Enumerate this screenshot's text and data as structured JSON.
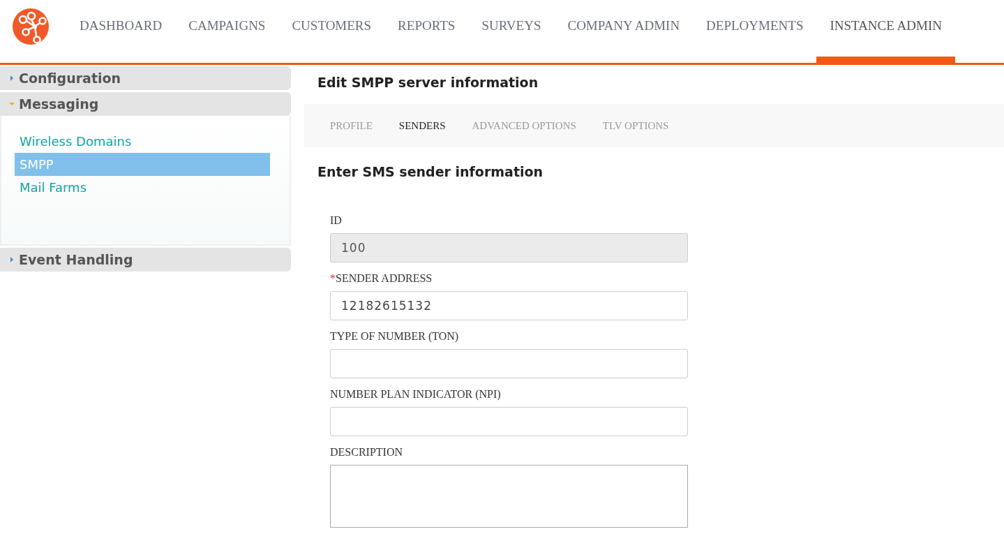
{
  "nav": {
    "items": [
      {
        "label": "DASHBOARD",
        "selected": false
      },
      {
        "label": "CAMPAIGNS",
        "selected": false
      },
      {
        "label": "CUSTOMERS",
        "selected": false
      },
      {
        "label": "REPORTS",
        "selected": false
      },
      {
        "label": "SURVEYS",
        "selected": false
      },
      {
        "label": "COMPANY ADMIN",
        "selected": false
      },
      {
        "label": "DEPLOYMENTS",
        "selected": false
      },
      {
        "label": "INSTANCE ADMIN",
        "selected": true
      }
    ]
  },
  "sidebar": {
    "sections": [
      {
        "label": "Configuration",
        "expanded": false
      },
      {
        "label": "Messaging",
        "expanded": true,
        "items": [
          {
            "label": "Wireless Domains",
            "selected": false
          },
          {
            "label": "SMPP",
            "selected": true
          },
          {
            "label": "Mail Farms",
            "selected": false
          }
        ]
      },
      {
        "label": "Event Handling",
        "expanded": false
      }
    ]
  },
  "main": {
    "title": "Edit SMPP server information",
    "tabs": [
      {
        "label": "PROFILE",
        "selected": false
      },
      {
        "label": "SENDERS",
        "selected": true
      },
      {
        "label": "ADVANCED OPTIONS",
        "selected": false
      },
      {
        "label": "TLV OPTIONS",
        "selected": false
      }
    ],
    "form_title": "Enter SMS sender information",
    "fields": [
      {
        "kind": "text",
        "label": "ID",
        "disabled": true,
        "value": "100"
      },
      {
        "kind": "text",
        "label": "SENDER ADDRESS",
        "required_mark": "*",
        "disabled": false,
        "value": "12182615132"
      },
      {
        "kind": "text",
        "label": "TYPE OF NUMBER (TON)",
        "disabled": false
      },
      {
        "kind": "text",
        "label": "NUMBER PLAN INDICATOR (NPI)",
        "disabled": false
      },
      {
        "kind": "textarea",
        "label": "DESCRIPTION",
        "disabled": false
      }
    ]
  }
}
